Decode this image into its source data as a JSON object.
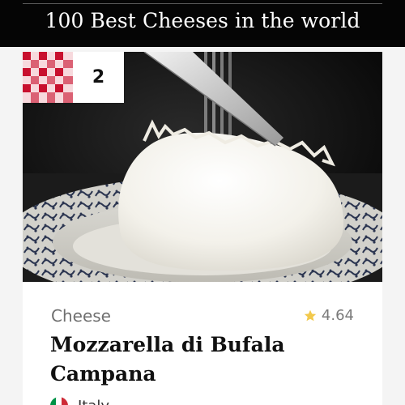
{
  "header": {
    "title": "100 Best Cheeses in the world"
  },
  "card": {
    "rank": "2",
    "rank_icon": "checkered-tablecloth-icon",
    "category": "Cheese",
    "rating": "4.64",
    "rating_icon": "star-icon",
    "name": "Mozzarella di Bufala Campana",
    "origin_country": "Italy",
    "origin_icon": "italy-flag-icon",
    "photo_subject": "mozzarella-cheese-photo"
  },
  "colors": {
    "header_bg": "#050505",
    "checker_red": "#c8102e",
    "star": "#f2c94c",
    "flag_green": "#009246",
    "flag_white": "#ffffff",
    "flag_red": "#ce2b37"
  }
}
